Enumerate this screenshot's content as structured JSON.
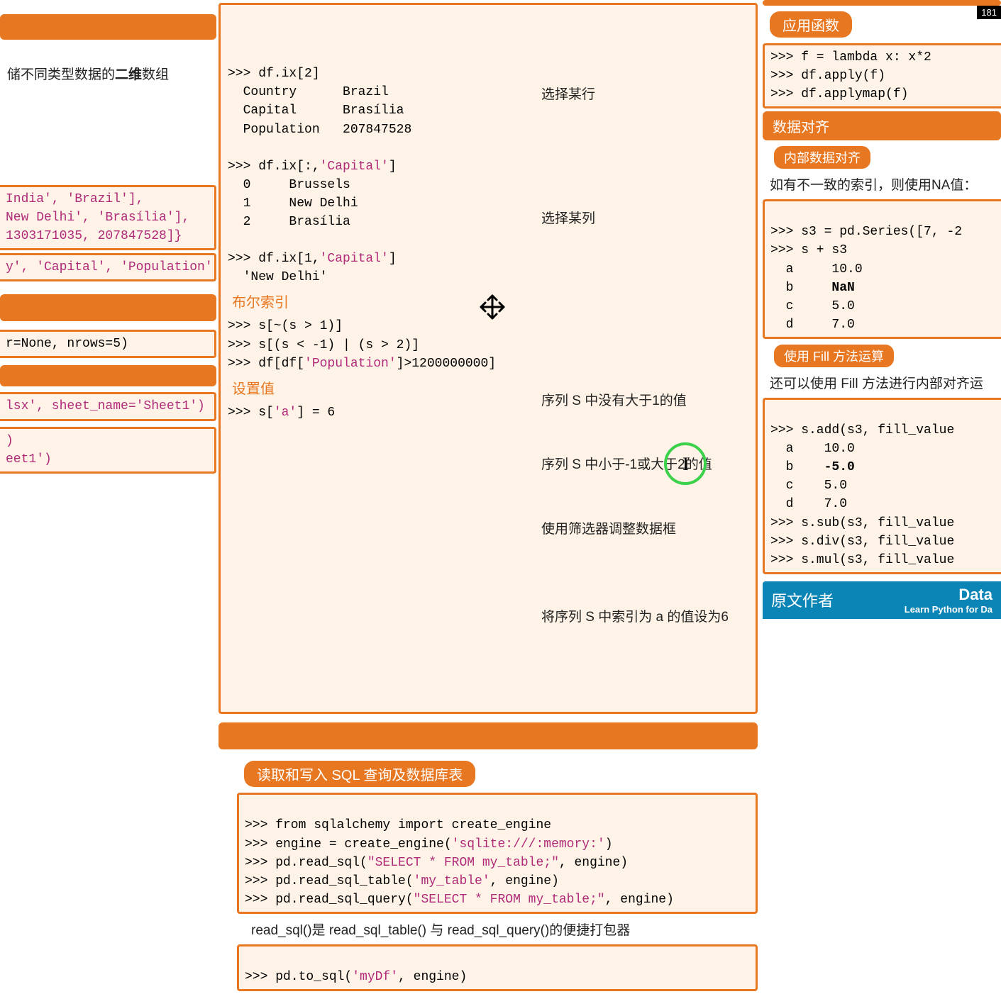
{
  "badge": "181",
  "left": {
    "desc_prefix": "储不同类型数据的",
    "desc_bold": "二维",
    "desc_suffix": "数组",
    "code1": "India', 'Brazil'],\nNew Delhi', 'Brasília'],\n1303171035, 207847528]}",
    "code2": "y', 'Capital', 'Population'])",
    "code3": "r=None, nrows=5)",
    "code4": "lsx', sheet_name='Sheet1')",
    "code5": ")\neet1')"
  },
  "mid": {
    "block1_code1": ">>> df.ix[2]\n  Country      Brazil\n  Capital      Brasília\n  Population   207847528",
    "block1_annot1": "选择某行",
    "block1_code2_a": ">>> df.ix[:,",
    "block1_code2_b": "'Capital'",
    "block1_code2_c": "]\n  0     Brussels\n  1     New Delhi\n  2     Brasília",
    "block1_annot2": "选择某列",
    "block1_code3_a": ">>> df.ix[1,",
    "block1_code3_b": "'Capital'",
    "block1_code3_c": "]\n  'New Delhi'",
    "sub1": "布尔索引",
    "bool_l1": ">>> s[~(s > 1)]",
    "bool_l2": ">>> s[(s < -1) | (s > 2)]",
    "bool_l3_a": ">>> df[df[",
    "bool_l3_b": "'Population'",
    "bool_l3_c": "]>1200000000]",
    "bool_a1": "序列 S 中没有大于1的值",
    "bool_a2": "序列 S 中小于-1或大于2的值",
    "bool_a3": "使用筛选器调整数据框",
    "sub2": "设置值",
    "set_l1_a": ">>> s[",
    "set_l1_b": "'a'",
    "set_l1_c": "] = 6",
    "set_a1": "将序列 S 中索引为 a 的值设为6",
    "sql_title": "读取和写入 SQL 查询及数据库表",
    "sql_code_l1": ">>> from sqlalchemy import create_engine",
    "sql_code_l2_a": ">>> engine = create_engine(",
    "sql_code_l2_b": "'sqlite:///:memory:'",
    "sql_code_l2_c": ")",
    "sql_code_l3_a": ">>> pd.read_sql(",
    "sql_code_l3_b": "\"SELECT * FROM my_table;\"",
    "sql_code_l3_c": ", engine)",
    "sql_code_l4_a": ">>> pd.read_sql_table(",
    "sql_code_l4_b": "'my_table'",
    "sql_code_l4_c": ", engine)",
    "sql_code_l5_a": ">>> pd.read_sql_query(",
    "sql_code_l5_b": "\"SELECT * FROM my_table;\"",
    "sql_code_l5_c": ", engine)",
    "sql_note": "read_sql()是 read_sql_table() 与 read_sql_query()的便捷打包器",
    "sql_code2_a": ">>> pd.to_sql(",
    "sql_code2_b": "'myDf'",
    "sql_code2_c": ", engine)"
  },
  "right": {
    "h1": "应用函数",
    "apply_code": ">>> f = lambda x: x*2\n>>> df.apply(f)\n>>> df.applymap(f)",
    "h2": "数据对齐",
    "h2_sub": "内部数据对齐",
    "align_note": "如有不一致的索引，则使用NA值：",
    "align_l1": ">>> s3 = pd.Series([7, -2",
    "align_l2": ">>> s + s3",
    "align_l3": "  a     10.0",
    "align_l4_a": "  b     ",
    "align_l4_b": "NaN",
    "align_l5": "  c     5.0",
    "align_l6": "  d     7.0",
    "h3": "使用 Fill 方法运算",
    "fill_note": "还可以使用 Fill 方法进行内部对齐运",
    "fill_l1": ">>> s.add(s3, fill_value",
    "fill_l2": "  a    10.0",
    "fill_l3_a": "  b    ",
    "fill_l3_b": "-5.0",
    "fill_l4": "  c    5.0",
    "fill_l5": "  d    7.0",
    "fill_l6": ">>> s.sub(s3, fill_value",
    "fill_l7": ">>> s.div(s3, fill_value",
    "fill_l8": ">>> s.mul(s3, fill_value",
    "footer_left": "原文作者",
    "footer_right_top": "Data",
    "footer_right_bot": "Learn Python for Da"
  }
}
